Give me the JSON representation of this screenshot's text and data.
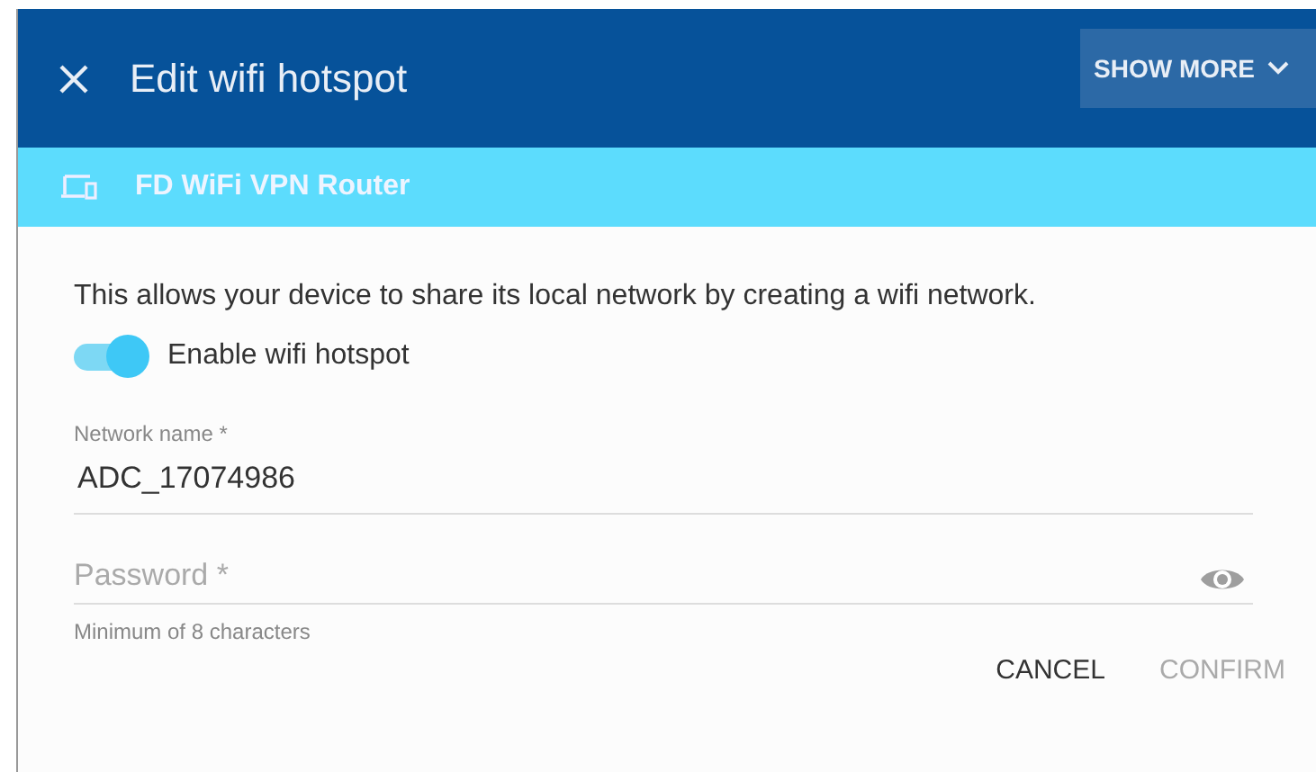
{
  "header": {
    "title": "Edit wifi hotspot",
    "show_more": "SHOW MORE"
  },
  "device": {
    "name": "FD WiFi VPN Router"
  },
  "description": "This allows your device to share its local network by creating a wifi network.",
  "toggle": {
    "label": "Enable wifi hotspot",
    "on": true
  },
  "fields": [
    {
      "kind": "text",
      "label": "Network name *",
      "value": "ADC_17074986"
    },
    {
      "kind": "password",
      "placeholder": "Password *",
      "hint": "Minimum of 8 characters"
    }
  ],
  "buttons": [
    {
      "label": "CANCEL",
      "disabled": false
    },
    {
      "label": "CONFIRM",
      "disabled": true
    }
  ]
}
